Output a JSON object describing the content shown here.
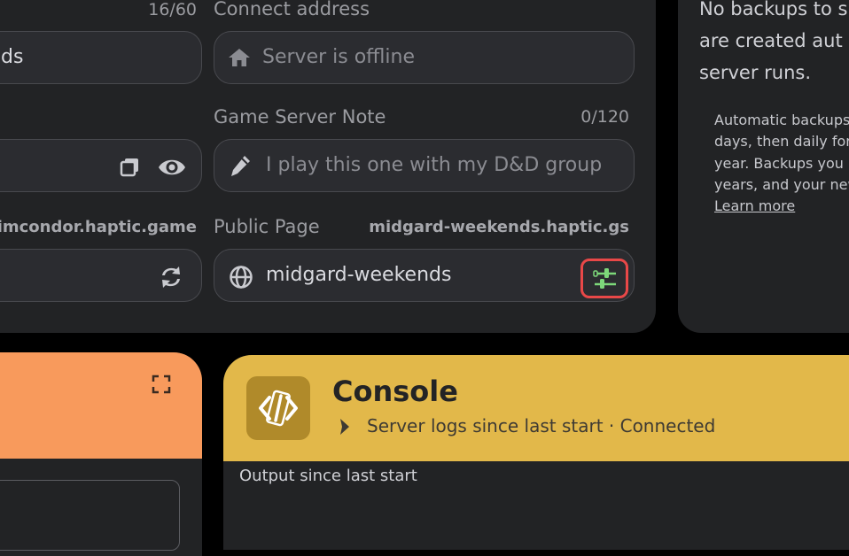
{
  "settings": {
    "name_counter": "16/60",
    "name_value_partial": "ds",
    "connect_address": {
      "label": "Connect address",
      "placeholder": "Server is offline"
    },
    "note": {
      "label": "Game Server Note",
      "counter": "0/120",
      "placeholder": "I play this one with my D&D group"
    },
    "host_domain_partial": "limcondor.haptic.game",
    "public_page": {
      "label": "Public Page",
      "url": "midgard-weekends.haptic.gs",
      "value": "midgard-weekends"
    }
  },
  "backups": {
    "heading_lines": [
      "No backups to s",
      "are created aut",
      "server runs."
    ],
    "info_lines": [
      "Automatic backups",
      "days, then daily for",
      "year. Backups you",
      "years, and your new"
    ],
    "learn_more": "Learn more"
  },
  "console": {
    "title": "Console",
    "subtitle": "Server logs since last start · Connected",
    "output_label": "Output since last start"
  },
  "colors": {
    "accent_orange": "#f89a5c",
    "accent_yellow": "#e2b84a",
    "highlight_red": "#e84848",
    "icon_green": "#7dd87a"
  }
}
